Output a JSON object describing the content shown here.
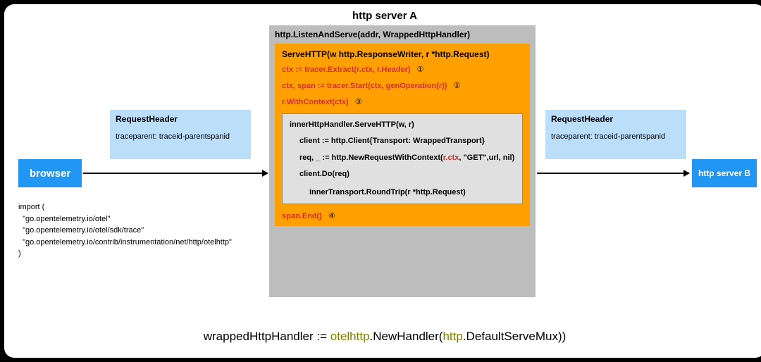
{
  "title": "http server A",
  "browser": {
    "label": "browser"
  },
  "request1": {
    "title": "RequestHeader",
    "line": "traceparent: traceid-parentspanid"
  },
  "request2": {
    "title": "RequestHeader",
    "line": "traceparent: traceid-parentspanid"
  },
  "serverB": {
    "label": "http server B"
  },
  "imports": {
    "open": "import (",
    "l1": "  \"go.opentelemetry.io/otel\"",
    "l2": "  \"go.opentelemetry.io/otel/sdk/trace\"",
    "l3": "  \"go.opentelemetry.io/contrib/instrumentation/net/http/otelhttp\"",
    "close": ")"
  },
  "outer": {
    "title": "http.ListenAndServe(addr, WrappedHttpHandler)",
    "serve": "ServeHTTP(w http.ResponseWriter, r *http.Request)",
    "red1": "ctx := tracer.Extract(r.ctx, r.Header)",
    "c1": "①",
    "red2": "ctx, span := tracer.Start(ctx, genOperation(r))",
    "c2": "②",
    "red3": "r.WithContext(ctx)",
    "c3": "③",
    "inner": {
      "l1": "innerHttpHandler.ServeHTTP(w, r)",
      "l2a": "client := http.Client{Transport: WrappedTransport}",
      "l2b_pre": "req, _ := http.NewRequestWithContext(",
      "l2b_rctx": "r.ctx",
      "l2b_post": ", \"GET\",url, nil)",
      "l2c": "client.Do(req)",
      "l3": "innerTransport.RoundTrip(r *http.Request)"
    },
    "red4": "span.End()",
    "c4": "④"
  },
  "bottom": {
    "p1": "wrappedHttpHandler := ",
    "p2": "otelhttp",
    "p3": ".NewHandler(",
    "p4": "http",
    "p5": ".DefaultServeMux))"
  }
}
